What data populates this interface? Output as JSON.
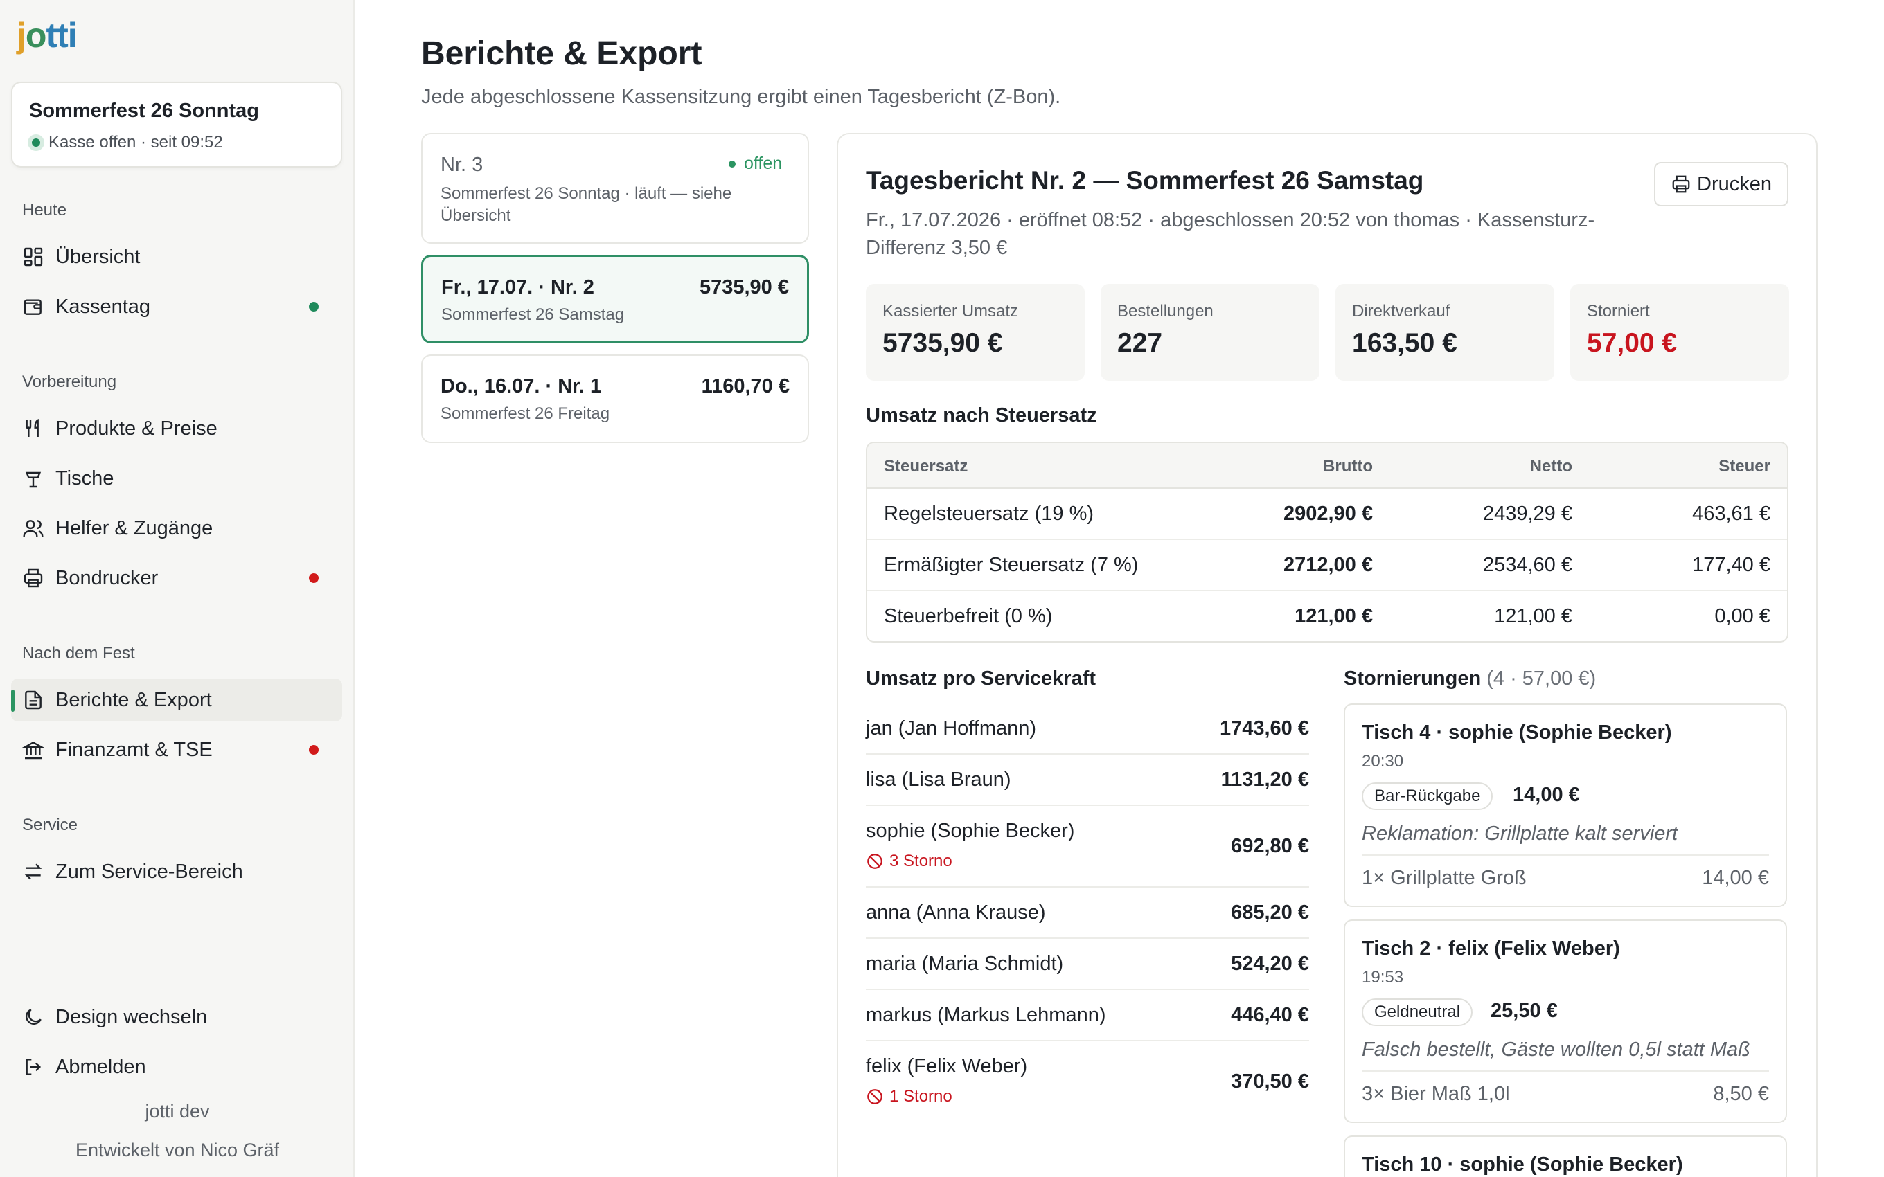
{
  "sidebar": {
    "logo_letters": [
      {
        "char": "j",
        "color": "#e0a02a"
      },
      {
        "char": "o",
        "color": "#3a8f5c"
      },
      {
        "char": "t",
        "color": "#2f7fb5"
      },
      {
        "char": "t",
        "color": "#2f7fb5"
      },
      {
        "char": "i",
        "color": "#2f7fb5"
      }
    ],
    "event": {
      "title": "Sommerfest 26 Sonntag",
      "status": "Kasse offen · seit 09:52"
    },
    "sections": {
      "today": "Heute",
      "prep": "Vorbereitung",
      "after": "Nach dem Fest",
      "service": "Service"
    },
    "items": {
      "overview": {
        "label": "Übersicht",
        "icon": "dashboard-icon"
      },
      "cashday": {
        "label": "Kassentag",
        "icon": "wallet-icon",
        "indicator": "green"
      },
      "products": {
        "label": "Produkte & Preise",
        "icon": "cutlery-icon"
      },
      "tables": {
        "label": "Tische",
        "icon": "table-icon"
      },
      "helpers": {
        "label": "Helfer & Zugänge",
        "icon": "users-icon"
      },
      "printer": {
        "label": "Bondrucker",
        "icon": "printer-icon",
        "indicator": "red"
      },
      "reports": {
        "label": "Berichte & Export",
        "icon": "document-icon",
        "active": true
      },
      "tax": {
        "label": "Finanzamt & TSE",
        "icon": "bank-icon",
        "indicator": "red"
      },
      "service_area": {
        "label": "Zum Service-Bereich",
        "icon": "swap-icon"
      }
    },
    "footer": {
      "theme": {
        "label": "Design wechseln",
        "icon": "moon-icon"
      },
      "logout": {
        "label": "Abmelden",
        "icon": "logout-icon"
      },
      "env": "jotti dev",
      "credit": "Entwickelt von Nico Gräf"
    }
  },
  "page": {
    "title": "Berichte & Export",
    "subtitle": "Jede abgeschlossene Kassensitzung ergibt einen Tagesbericht (Z-Bon)."
  },
  "reports": [
    {
      "title": "Nr. 3",
      "sub": "Sommerfest 26 Sonntag · läuft — siehe Übersicht",
      "badge": "offen",
      "open": true
    },
    {
      "title": "Fr., 17.07. · Nr. 2",
      "amount": "5735,90 €",
      "sub": "Sommerfest 26 Samstag",
      "selected": true
    },
    {
      "title": "Do., 16.07. · Nr. 1",
      "amount": "1160,70 €",
      "sub": "Sommerfest 26 Freitag"
    }
  ],
  "detail": {
    "title": "Tagesbericht Nr. 2 — Sommerfest 26 Samstag",
    "meta": "Fr., 17.07.2026 · eröffnet 08:52 · abgeschlossen 20:52 von thomas · Kassensturz-Differenz 3,50 €",
    "print_label": "Drucken",
    "stats": [
      {
        "label": "Kassierter Umsatz",
        "value": "5735,90 €"
      },
      {
        "label": "Bestellungen",
        "value": "227"
      },
      {
        "label": "Direktverkauf",
        "value": "163,50 €"
      },
      {
        "label": "Storniert",
        "value": "57,00 €",
        "color": "#c8141e"
      }
    ],
    "tax_heading": "Umsatz nach Steuersatz",
    "tax_table": {
      "columns": [
        "Steuersatz",
        "Brutto",
        "Netto",
        "Steuer"
      ],
      "rows": [
        [
          "Regelsteuersatz (19 %)",
          "2902,90 €",
          "2439,29 €",
          "463,61 €"
        ],
        [
          "Ermäßigter Steuersatz (7 %)",
          "2712,00 €",
          "2534,60 €",
          "177,40 €"
        ],
        [
          "Steuerbefreit (0 %)",
          "121,00 €",
          "121,00 €",
          "0,00 €"
        ]
      ]
    },
    "staff_heading": "Umsatz pro Servicekraft",
    "staff": [
      {
        "name": "jan (Jan Hoffmann)",
        "amount": "1743,60 €"
      },
      {
        "name": "lisa (Lisa Braun)",
        "amount": "1131,20 €"
      },
      {
        "name": "sophie (Sophie Becker)",
        "amount": "692,80 €",
        "storno": "3 Storno"
      },
      {
        "name": "anna (Anna Krause)",
        "amount": "685,20 €"
      },
      {
        "name": "maria (Maria Schmidt)",
        "amount": "524,20 €"
      },
      {
        "name": "markus (Markus Lehmann)",
        "amount": "446,40 €"
      },
      {
        "name": "felix (Felix Weber)",
        "amount": "370,50 €",
        "storno": "1 Storno"
      }
    ],
    "voids_heading": "Stornierungen",
    "voids_summary": "(4 · 57,00 €)",
    "voids": [
      {
        "title": "Tisch 4 · sophie (Sophie Becker)",
        "time": "20:30",
        "tag": "Bar-Rückgabe",
        "amount": "14,00 €",
        "reason": "Reklamation: Grillplatte kalt serviert",
        "item": "1× Grillplatte Groß",
        "item_price": "14,00 €"
      },
      {
        "title": "Tisch 2 · felix (Felix Weber)",
        "time": "19:53",
        "tag": "Geldneutral",
        "amount": "25,50 €",
        "reason": "Falsch bestellt, Gäste wollten 0,5l statt Maß",
        "item": "3× Bier Maß 1,0l",
        "item_price": "8,50 €"
      },
      {
        "title": "Tisch 10 · sophie (Sophie Becker)"
      }
    ]
  }
}
